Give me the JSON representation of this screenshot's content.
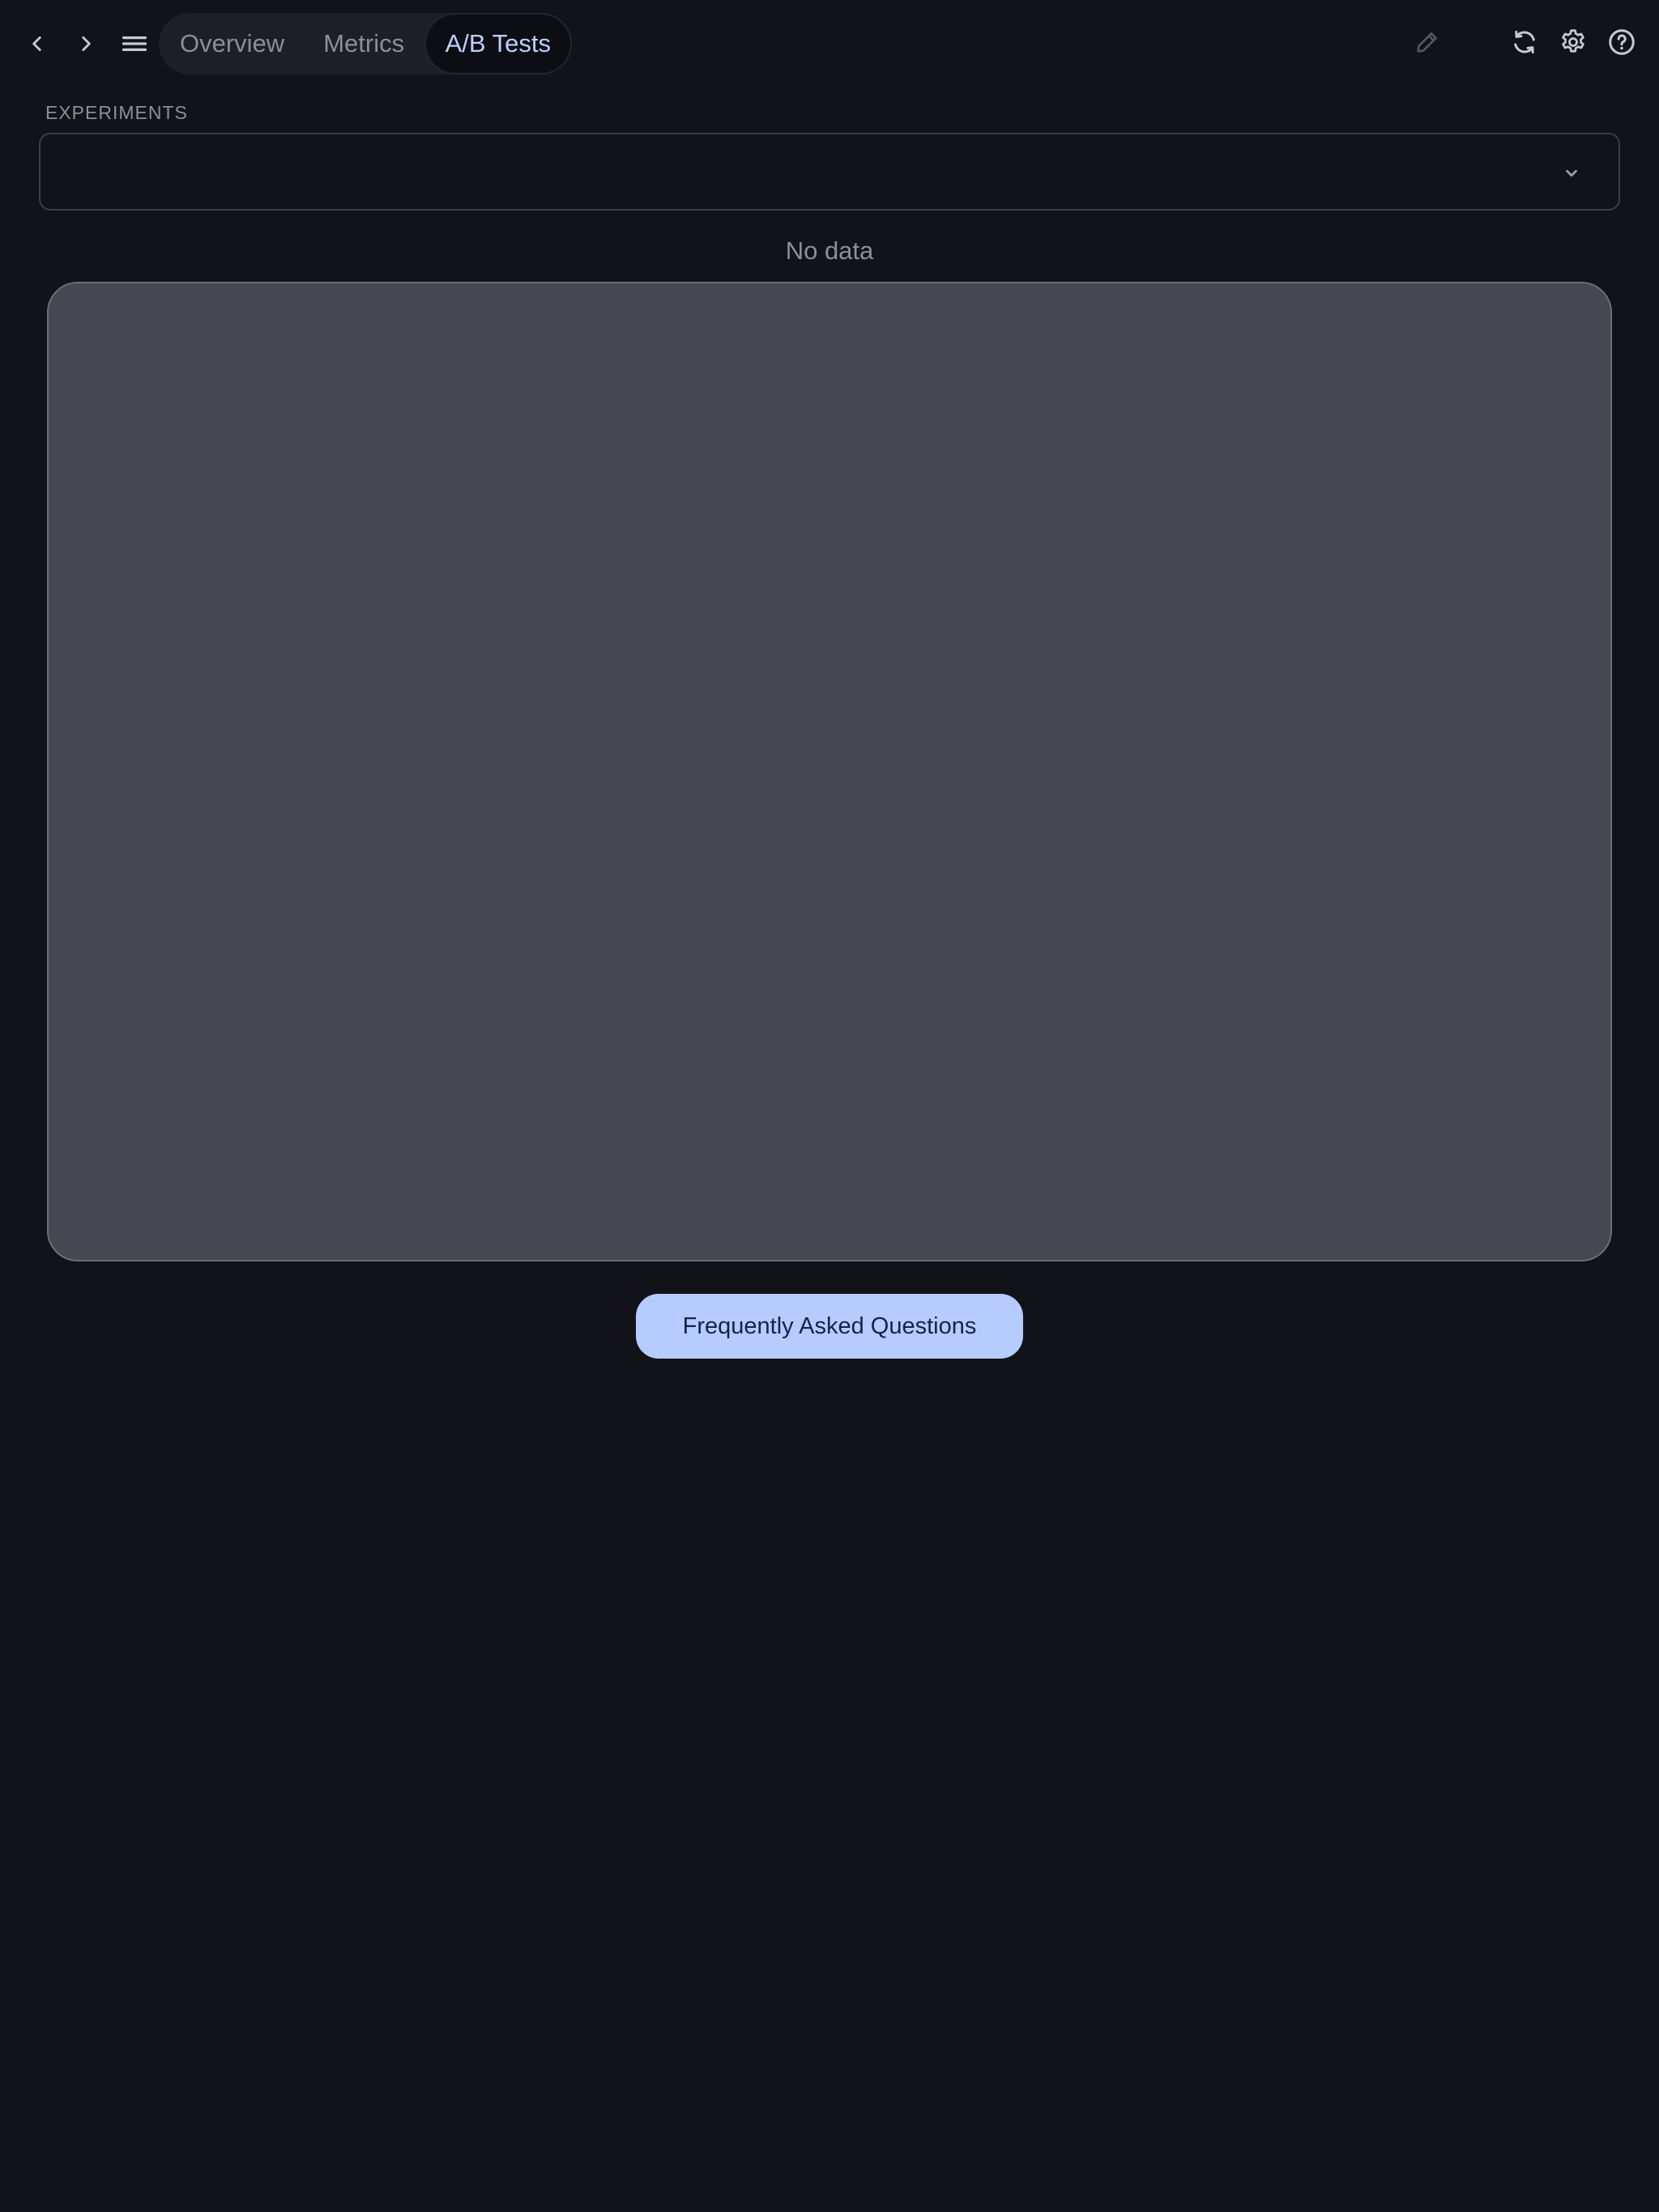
{
  "toolbar": {
    "back_icon": "chevron-left-icon",
    "forward_icon": "chevron-right-icon",
    "menu_icon": "hamburger-menu-icon",
    "edit_icon": "pencil-icon",
    "refresh_icon": "refresh-icon",
    "settings_icon": "gear-icon",
    "help_icon": "help-circle-icon"
  },
  "tabs": [
    {
      "label": "Overview",
      "active": false
    },
    {
      "label": "Metrics",
      "active": false
    },
    {
      "label": "A/B Tests",
      "active": true
    }
  ],
  "experiments": {
    "label": "EXPERIMENTS",
    "selected_value": "",
    "chevron_icon": "chevron-down-icon"
  },
  "results": {
    "empty_message": "No data"
  },
  "faq": {
    "label": "Frequently Asked Questions"
  },
  "colors": {
    "background": "#121319",
    "accent": "#b6ccff",
    "active_tab_text": "#bcd0ff",
    "panel": "#454751"
  }
}
